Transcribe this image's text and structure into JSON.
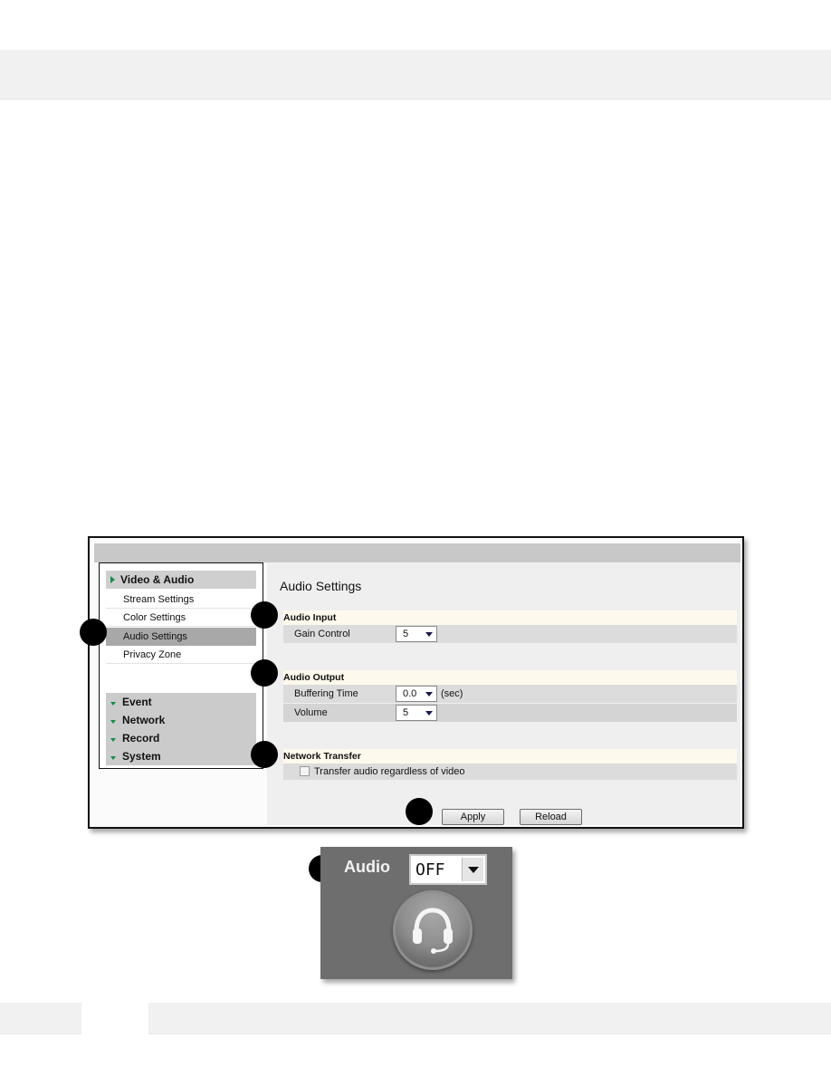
{
  "sidebar": {
    "group_header": "Video & Audio",
    "items": [
      {
        "label": "Stream Settings",
        "active": false
      },
      {
        "label": "Color Settings",
        "active": false
      },
      {
        "label": "Audio Settings",
        "active": true
      },
      {
        "label": "Privacy Zone",
        "active": false
      }
    ],
    "collapsed_groups": [
      "Event",
      "Network",
      "Record",
      "System"
    ]
  },
  "content": {
    "title": "Audio Settings",
    "audio_input": {
      "header": "Audio Input",
      "gain_control_label": "Gain Control",
      "gain_control_value": "5"
    },
    "audio_output": {
      "header": "Audio Output",
      "buffering_time_label": "Buffering Time",
      "buffering_time_value": "0.0",
      "buffering_time_unit": "(sec)",
      "volume_label": "Volume",
      "volume_value": "5"
    },
    "network_transfer": {
      "header": "Network Transfer",
      "checkbox_label": "Transfer audio regardless of video",
      "checked": false
    },
    "buttons": {
      "apply": "Apply",
      "reload": "Reload"
    }
  },
  "audio_widget": {
    "label": "Audio",
    "select_value": "OFF",
    "icon": "headset-icon"
  },
  "colors": {
    "accent_green": "#1a8a4a",
    "nav_active": "#a8a8a8",
    "section_header_bg": "#fdf9ec"
  }
}
